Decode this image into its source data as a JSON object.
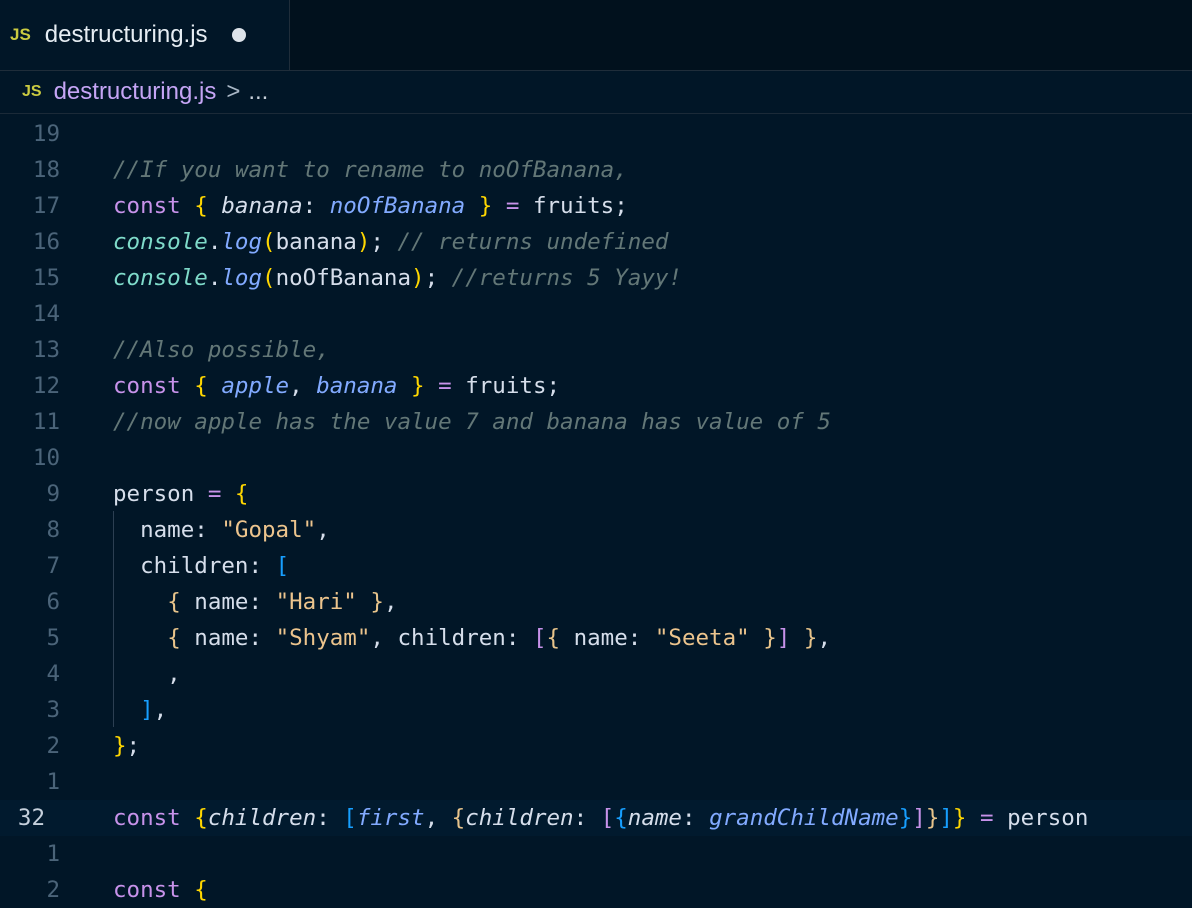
{
  "tab": {
    "icon": "JS",
    "filename": "destructuring.js",
    "dirty": true
  },
  "breadcrumb": {
    "icon": "JS",
    "file": "destructuring.js",
    "separator": ">",
    "more": "..."
  },
  "editor": {
    "lines": [
      {
        "ln": "19",
        "segs": []
      },
      {
        "ln": "18",
        "segs": [
          [
            "c",
            "//If you want to rename to noOfBanana,"
          ]
        ]
      },
      {
        "ln": "17",
        "segs": [
          [
            "k",
            "const"
          ],
          [
            "t",
            " "
          ],
          [
            "b1",
            "{"
          ],
          [
            "t",
            " "
          ],
          [
            "vi",
            "banana"
          ],
          [
            "p",
            ":"
          ],
          [
            "t",
            " "
          ],
          [
            "vp",
            "noOfBanana"
          ],
          [
            "t",
            " "
          ],
          [
            "b1",
            "}"
          ],
          [
            "t",
            " "
          ],
          [
            "o",
            "="
          ],
          [
            "t",
            " fruits;"
          ]
        ]
      },
      {
        "ln": "16",
        "segs": [
          [
            "cn",
            "console"
          ],
          [
            "p",
            "."
          ],
          [
            "fn",
            "log"
          ],
          [
            "b1",
            "("
          ],
          [
            "t",
            "banana"
          ],
          [
            "b1",
            ")"
          ],
          [
            "t",
            "; "
          ],
          [
            "c",
            "// returns undefined"
          ]
        ]
      },
      {
        "ln": "15",
        "segs": [
          [
            "cn",
            "console"
          ],
          [
            "p",
            "."
          ],
          [
            "fn",
            "log"
          ],
          [
            "b1",
            "("
          ],
          [
            "t",
            "noOfBanana"
          ],
          [
            "b1",
            ")"
          ],
          [
            "t",
            "; "
          ],
          [
            "c",
            "//returns 5 Yayy!"
          ]
        ]
      },
      {
        "ln": "14",
        "segs": []
      },
      {
        "ln": "13",
        "segs": [
          [
            "c",
            "//Also possible,"
          ]
        ]
      },
      {
        "ln": "12",
        "segs": [
          [
            "k",
            "const"
          ],
          [
            "t",
            " "
          ],
          [
            "b1",
            "{"
          ],
          [
            "t",
            " "
          ],
          [
            "vp",
            "apple"
          ],
          [
            "p",
            ", "
          ],
          [
            "vp",
            "banana"
          ],
          [
            "t",
            " "
          ],
          [
            "b1",
            "}"
          ],
          [
            "t",
            " "
          ],
          [
            "o",
            "="
          ],
          [
            "t",
            " fruits;"
          ]
        ]
      },
      {
        "ln": "11",
        "segs": [
          [
            "c",
            "//now apple has the value 7 and banana has value of 5"
          ]
        ]
      },
      {
        "ln": "10",
        "segs": []
      },
      {
        "ln": "9",
        "segs": [
          [
            "t",
            "person "
          ],
          [
            "o",
            "="
          ],
          [
            "t",
            " "
          ],
          [
            "b1",
            "{"
          ]
        ]
      },
      {
        "ln": "8",
        "segs": [
          [
            "t",
            "  name: "
          ],
          [
            "s",
            "\"Gopal\""
          ],
          [
            "t",
            ","
          ]
        ]
      },
      {
        "ln": "7",
        "segs": [
          [
            "t",
            "  children: "
          ],
          [
            "b3",
            "["
          ]
        ]
      },
      {
        "ln": "6",
        "segs": [
          [
            "t",
            "    "
          ],
          [
            "bb",
            "{"
          ],
          [
            "t",
            " name: "
          ],
          [
            "s",
            "\"Hari\""
          ],
          [
            "t",
            " "
          ],
          [
            "bb",
            "}"
          ],
          [
            "t",
            ","
          ]
        ]
      },
      {
        "ln": "5",
        "segs": [
          [
            "t",
            "    "
          ],
          [
            "bb",
            "{"
          ],
          [
            "t",
            " name: "
          ],
          [
            "s",
            "\"Shyam\""
          ],
          [
            "t",
            ", children: "
          ],
          [
            "bo",
            "["
          ],
          [
            "bb",
            "{"
          ],
          [
            "t",
            " name: "
          ],
          [
            "s",
            "\"Seeta\""
          ],
          [
            "t",
            " "
          ],
          [
            "bb",
            "}"
          ],
          [
            "bo",
            "]"
          ],
          [
            "t",
            " "
          ],
          [
            "bb",
            "}"
          ],
          [
            "t",
            ","
          ]
        ]
      },
      {
        "ln": "4",
        "segs": [
          [
            "t",
            "    ,"
          ]
        ]
      },
      {
        "ln": "3",
        "segs": [
          [
            "t",
            "  "
          ],
          [
            "b3",
            "]"
          ],
          [
            "t",
            ","
          ]
        ]
      },
      {
        "ln": "2",
        "segs": [
          [
            "b1",
            "}"
          ],
          [
            "t",
            ";"
          ]
        ]
      },
      {
        "ln": "1",
        "segs": []
      },
      {
        "ln": "32",
        "current": true,
        "segs": [
          [
            "k",
            "const"
          ],
          [
            "t",
            " "
          ],
          [
            "b1",
            "{"
          ],
          [
            "vi",
            "children"
          ],
          [
            "p",
            ": "
          ],
          [
            "b3",
            "["
          ],
          [
            "vp",
            "first"
          ],
          [
            "p",
            ", "
          ],
          [
            "bb",
            "{"
          ],
          [
            "vi",
            "children"
          ],
          [
            "p",
            ": "
          ],
          [
            "bo",
            "["
          ],
          [
            "b3",
            "{"
          ],
          [
            "vi",
            "name"
          ],
          [
            "p",
            ": "
          ],
          [
            "vp",
            "grandChildName"
          ],
          [
            "b3",
            "}"
          ],
          [
            "bo",
            "]"
          ],
          [
            "bb",
            "}"
          ],
          [
            "b3",
            "]"
          ],
          [
            "b1",
            "}"
          ],
          [
            "t",
            " "
          ],
          [
            "o",
            "="
          ],
          [
            "t",
            " person"
          ]
        ]
      },
      {
        "ln": "1",
        "segs": []
      },
      {
        "ln": "2",
        "segs": [
          [
            "k",
            "const"
          ],
          [
            "t",
            " "
          ],
          [
            "b1",
            "{"
          ]
        ]
      }
    ]
  }
}
